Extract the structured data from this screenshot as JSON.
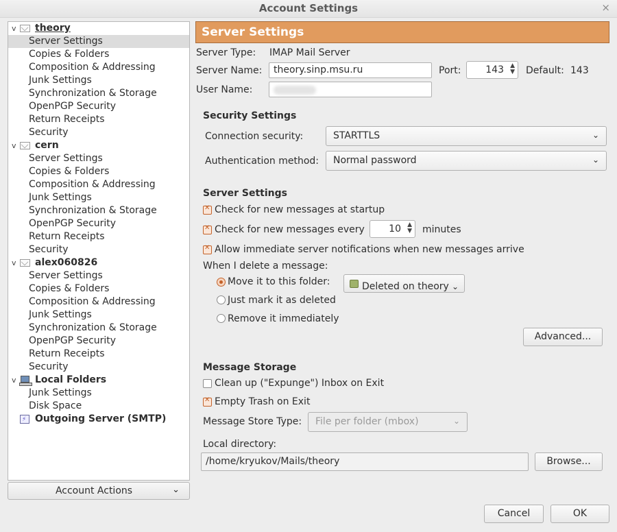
{
  "window": {
    "title": "Account Settings",
    "close_glyph": "×"
  },
  "tree": {
    "accounts": [
      {
        "name": "theory",
        "items": [
          "Server Settings",
          "Copies & Folders",
          "Composition & Addressing",
          "Junk Settings",
          "Synchronization & Storage",
          "OpenPGP Security",
          "Return Receipts",
          "Security"
        ]
      },
      {
        "name": "cern",
        "items": [
          "Server Settings",
          "Copies & Folders",
          "Composition & Addressing",
          "Junk Settings",
          "Synchronization & Storage",
          "OpenPGP Security",
          "Return Receipts",
          "Security"
        ]
      },
      {
        "name": "alex060826",
        "items": [
          "Server Settings",
          "Copies & Folders",
          "Composition & Addressing",
          "Junk Settings",
          "Synchronization & Storage",
          "OpenPGP Security",
          "Return Receipts",
          "Security"
        ]
      }
    ],
    "local": {
      "name": "Local Folders",
      "items": [
        "Junk Settings",
        "Disk Space"
      ]
    },
    "outgoing": "Outgoing Server (SMTP)",
    "selected": "theory / Server Settings"
  },
  "account_actions": {
    "label": "Account Actions",
    "chevron": "⌄"
  },
  "panel": {
    "header": "Server Settings",
    "server_type_label": "Server Type:",
    "server_type_value": "IMAP Mail Server",
    "server_name_label": "Server Name:",
    "server_name_value": "theory.sinp.msu.ru",
    "port_label": "Port:",
    "port_value": "143",
    "default_label": "Default:",
    "default_value": "143",
    "user_name_label": "User Name:",
    "user_name_value": ""
  },
  "security": {
    "title": "Security Settings",
    "connection_label": "Connection security:",
    "connection_value": "STARTTLS",
    "auth_label": "Authentication method:",
    "auth_value": "Normal password"
  },
  "server_settings": {
    "title": "Server Settings",
    "check_startup": {
      "label": "Check for new messages at startup",
      "checked": true
    },
    "check_every": {
      "label": "Check for new messages every",
      "checked": true,
      "value": "10",
      "unit": "minutes"
    },
    "allow_notify": {
      "label": "Allow immediate server notifications when new messages arrive",
      "checked": true
    },
    "delete_label": "When I delete a message:",
    "delete_options": {
      "move": {
        "label": "Move it to this folder:",
        "selected": true
      },
      "mark": {
        "label": "Just mark it as deleted",
        "selected": false
      },
      "remove": {
        "label": "Remove it immediately",
        "selected": false
      }
    },
    "folder_value": "Deleted on theory",
    "advanced_label": "Advanced..."
  },
  "storage": {
    "title": "Message Storage",
    "cleanup": {
      "label": "Clean up (\"Expunge\") Inbox on Exit",
      "checked": false
    },
    "empty_trash": {
      "label": "Empty Trash on Exit",
      "checked": true
    },
    "store_type_label": "Message Store Type:",
    "store_type_value": "File per folder (mbox)",
    "local_dir_label": "Local directory:",
    "local_dir_value": "/home/kryukov/Mails/theory",
    "browse_label": "Browse..."
  },
  "footer": {
    "cancel_label": "Cancel",
    "ok_label": "OK"
  },
  "colors": {
    "accent": "#e19b5e",
    "check": "#c3622a"
  }
}
